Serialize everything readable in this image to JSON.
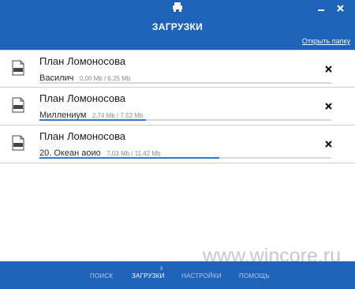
{
  "window": {
    "title": "ЗАГРУЗКИ",
    "open_folder_link": "Открыть папку",
    "app_icon": "car-icon",
    "minimize_icon": "minimize-icon",
    "close_icon": "close-icon"
  },
  "downloads": [
    {
      "title": "План Ломоносова",
      "track": "Василич",
      "progress": "0,00 Mb / 6,25 Mb",
      "fraction": 0.0,
      "icon": "mp3-file-icon",
      "remove_icon": "close-icon"
    },
    {
      "title": "План Ломоносова",
      "track": "Миллениум",
      "progress": "2,74 Mb / 7,52 Mb",
      "fraction": 0.364,
      "icon": "mp3-file-icon",
      "remove_icon": "close-icon"
    },
    {
      "title": "План Ломоносова",
      "track": "20. Океан аоио",
      "progress": "7,03 Mb / 11,42 Mb",
      "fraction": 0.616,
      "icon": "mp3-file-icon",
      "remove_icon": "close-icon"
    }
  ],
  "nav": {
    "search": "ПОИСК",
    "downloads": "ЗАГРУЗКИ",
    "downloads_badge": "3",
    "settings": "НАСТРОЙКИ",
    "help": "ПОМОЩЬ"
  },
  "watermark": "www.wincore.ru",
  "colors": {
    "accent": "#1f63b8",
    "progress": "#2f7ad6"
  }
}
